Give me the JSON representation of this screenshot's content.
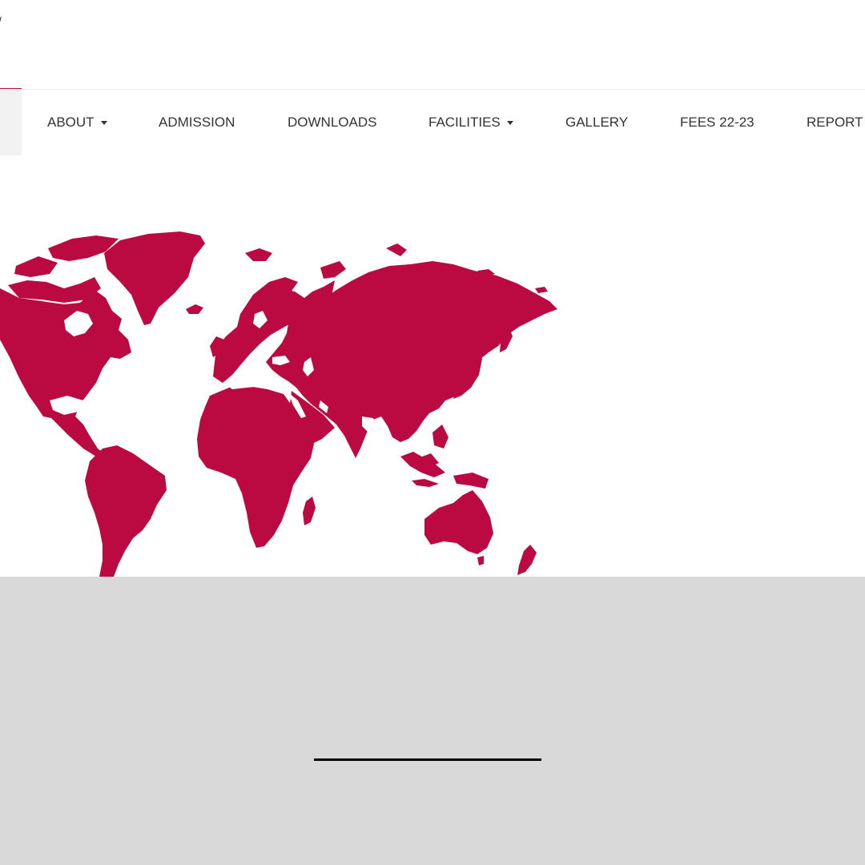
{
  "colors": {
    "brand": "#bb0a42",
    "nav_text": "#333333",
    "footer_bg": "#d9d9d9"
  },
  "nav": {
    "items": [
      {
        "label": "ABOUT",
        "dropdown": true
      },
      {
        "label": "ADMISSION",
        "dropdown": false
      },
      {
        "label": "DOWNLOADS",
        "dropdown": false
      },
      {
        "label": "FACILITIES",
        "dropdown": true
      },
      {
        "label": "GALLERY",
        "dropdown": false
      },
      {
        "label": "FEES 22-23",
        "dropdown": false
      },
      {
        "label": "REPORT",
        "dropdown": false
      }
    ]
  },
  "hero": {
    "image": "world-map"
  }
}
